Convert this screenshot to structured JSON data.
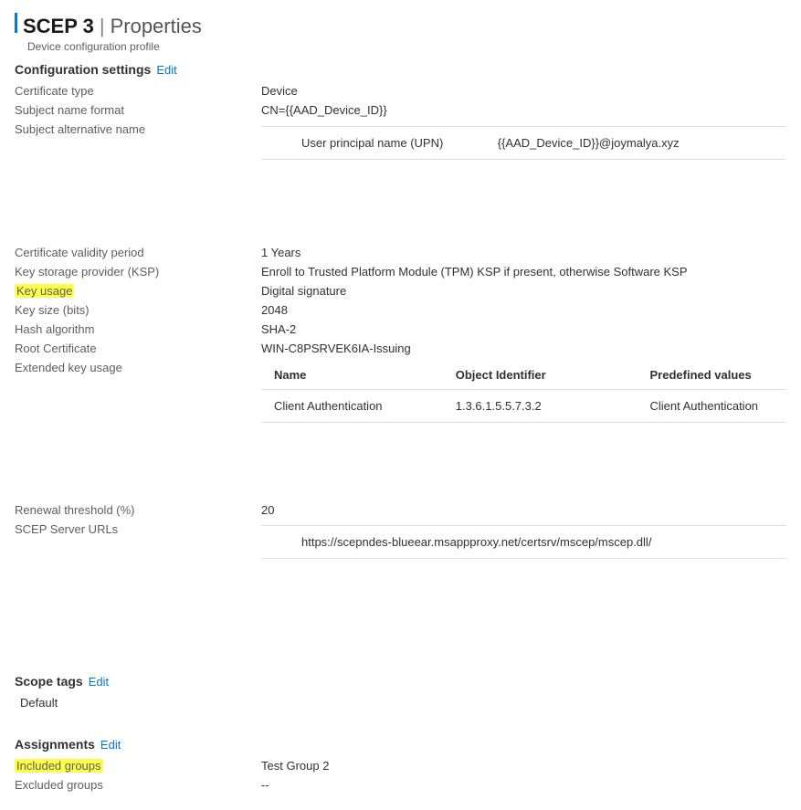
{
  "header": {
    "title": "SCEP 3",
    "divider": "|",
    "part": "Properties",
    "subtitle": "Device configuration profile"
  },
  "sections": {
    "config": {
      "title": "Configuration settings",
      "edit": "Edit"
    },
    "scope": {
      "title": "Scope tags",
      "edit": "Edit",
      "default": "Default"
    },
    "assign": {
      "title": "Assignments",
      "edit": "Edit"
    }
  },
  "props": {
    "cert_type": {
      "label": "Certificate type",
      "value": "Device"
    },
    "snf": {
      "label": "Subject name format",
      "value": "CN={{AAD_Device_ID}}"
    },
    "san": {
      "label": "Subject alternative name"
    },
    "validity": {
      "label": "Certificate validity period",
      "value": "1 Years"
    },
    "ksp": {
      "label": "Key storage provider (KSP)",
      "value": "Enroll to Trusted Platform Module (TPM) KSP if present, otherwise Software KSP"
    },
    "key_usage": {
      "label": "Key usage",
      "value": "Digital signature"
    },
    "key_size": {
      "label": "Key size (bits)",
      "value": "2048"
    },
    "hash": {
      "label": "Hash algorithm",
      "value": "SHA-2"
    },
    "root_cert": {
      "label": "Root Certificate",
      "value": "WIN-C8PSRVEK6IA-Issuing"
    },
    "eku": {
      "label": "Extended key usage"
    },
    "renewal": {
      "label": "Renewal threshold (%)",
      "value": "20"
    },
    "scep_urls": {
      "label": "SCEP Server URLs"
    },
    "incl_groups": {
      "label": "Included groups",
      "value": "Test Group 2"
    },
    "excl_groups": {
      "label": "Excluded groups",
      "value": "--"
    }
  },
  "san": {
    "type": "User principal name (UPN)",
    "value": "{{AAD_Device_ID}}@joymalya.xyz"
  },
  "eku_table": {
    "headers": {
      "name": "Name",
      "oid": "Object Identifier",
      "pre": "Predefined values"
    },
    "row": {
      "name": "Client Authentication",
      "oid": "1.3.6.1.5.5.7.3.2",
      "pre": "Client Authentication"
    }
  },
  "scep_url": "https://scepndes-blueear.msappproxy.net/certsrv/mscep/mscep.dll/"
}
